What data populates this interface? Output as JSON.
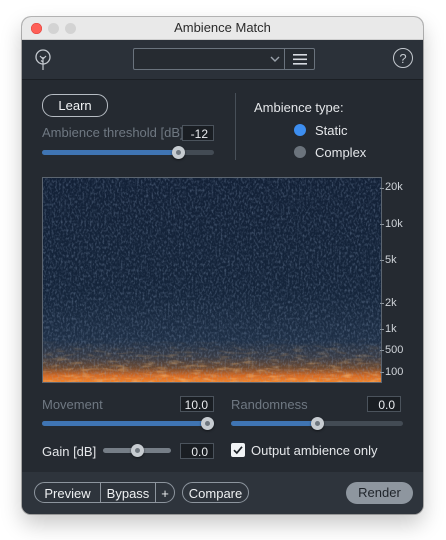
{
  "window": {
    "title": "Ambience Match"
  },
  "toolbar": {
    "preset_value": "",
    "help_label": "?"
  },
  "learn": {
    "label": "Learn"
  },
  "threshold": {
    "label": "Ambience threshold [dB]",
    "value": "-12",
    "level": 0.82
  },
  "ambience_type": {
    "label": "Ambience type:",
    "options": [
      {
        "label": "Static",
        "selected": true
      },
      {
        "label": "Complex",
        "selected": false
      }
    ]
  },
  "spectrogram": {
    "freq_labels": [
      "20k",
      "10k",
      "5k",
      "2k",
      "1k",
      "500",
      "100"
    ]
  },
  "movement": {
    "label": "Movement",
    "value": "10.0",
    "level": 1.0
  },
  "randomness": {
    "label": "Randomness",
    "value": "0.0",
    "level": 0.5
  },
  "gain": {
    "label": "Gain [dB]",
    "value": "0.0",
    "level": 0.5
  },
  "output_only": {
    "label": "Output ambience only",
    "checked": true
  },
  "bottom": {
    "preview": "Preview",
    "bypass": "Bypass",
    "plus": "+",
    "compare": "Compare",
    "render": "Render"
  },
  "colors": {
    "accent": "#3f74b3",
    "radio_selected": "#3d8ef0",
    "panel": "#252a31"
  }
}
